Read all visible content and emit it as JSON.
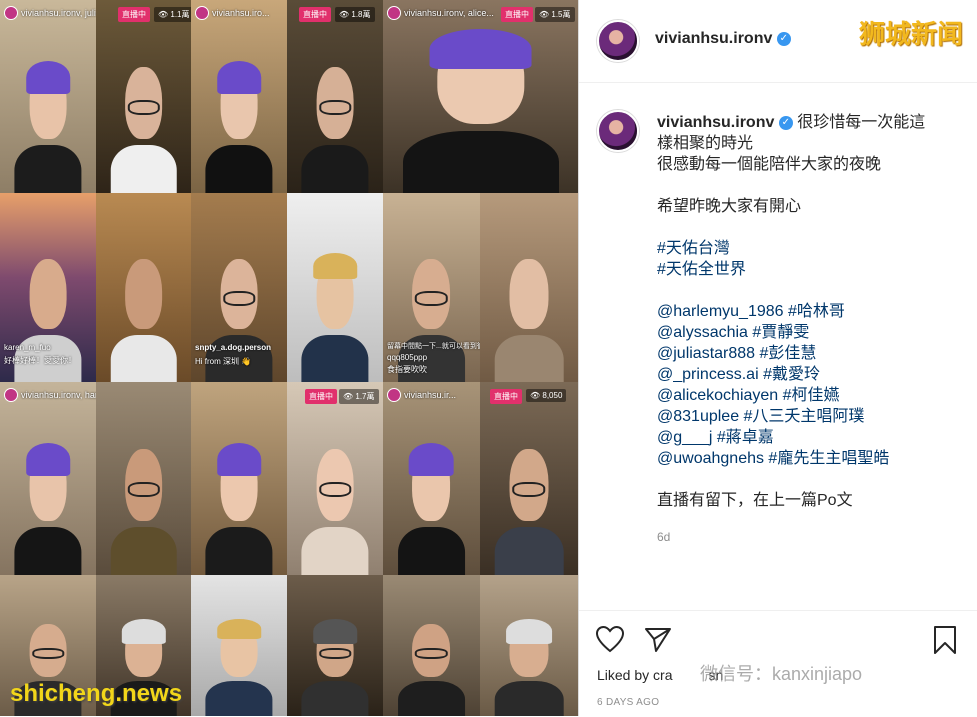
{
  "post": {
    "username": "vivianhsu.ironv",
    "caption_lines": [
      "很珍惜每一次能這",
      "樣相聚的時光",
      "很感動每一個能陪伴大家的夜晚",
      "",
      "希望昨晚大家有開心",
      "",
      "#天佑台灣",
      "#天佑全世界",
      "",
      "@harlemyu_1986 #哈林哥",
      "@alyssachia #賈靜雯",
      "@juliastar888 #彭佳慧",
      "@_princess.ai #戴愛玲",
      "@alicekochiayen #柯佳嬿",
      "@831uplee #八三夭主唱阿璞",
      "@g___j #蔣卓嘉",
      "@uwoahgnehs #龐先生主唱聖皓",
      "",
      "直播有留下，在上一篇Po文"
    ],
    "age": "6d",
    "liked_by": "Liked by cra",
    "liked_by_end": "sn",
    "days_ago": "6 DAYS AGO"
  },
  "overlays": {
    "u1": "vivianhsu.ironv, julias...",
    "u2": "vivianhsu.iro...",
    "u3": "vivianhsu.ironv, alice...",
    "u4": "vivianhsu.ironv, harle...",
    "u5": "vivianhsu.ir...",
    "live": "直播中",
    "v1": "👁 1.1萬",
    "v2": "👁 1.8萬",
    "v3": "👁 1.5萬",
    "v4": "👁 1.7萬",
    "v5": "👁 8,050",
    "c1a": "karen_m_fuo",
    "c1b": "好棒好棒！愛愛你！",
    "c2a": "snpty_a.dog.person",
    "c2b": "Hi from 深圳 👋",
    "c3a": "留幕中間點一下...就可以看到彼此的臉了",
    "c3b": "qqq805ppp",
    "c3c": "食指要吹吹"
  },
  "watermarks": {
    "top": "狮城新闻",
    "bottom": "shicheng.news",
    "center": "微信号：kanxinjiapo"
  },
  "icons": [
    "verified-icon",
    "heart-icon",
    "share-icon",
    "bookmark-icon"
  ]
}
